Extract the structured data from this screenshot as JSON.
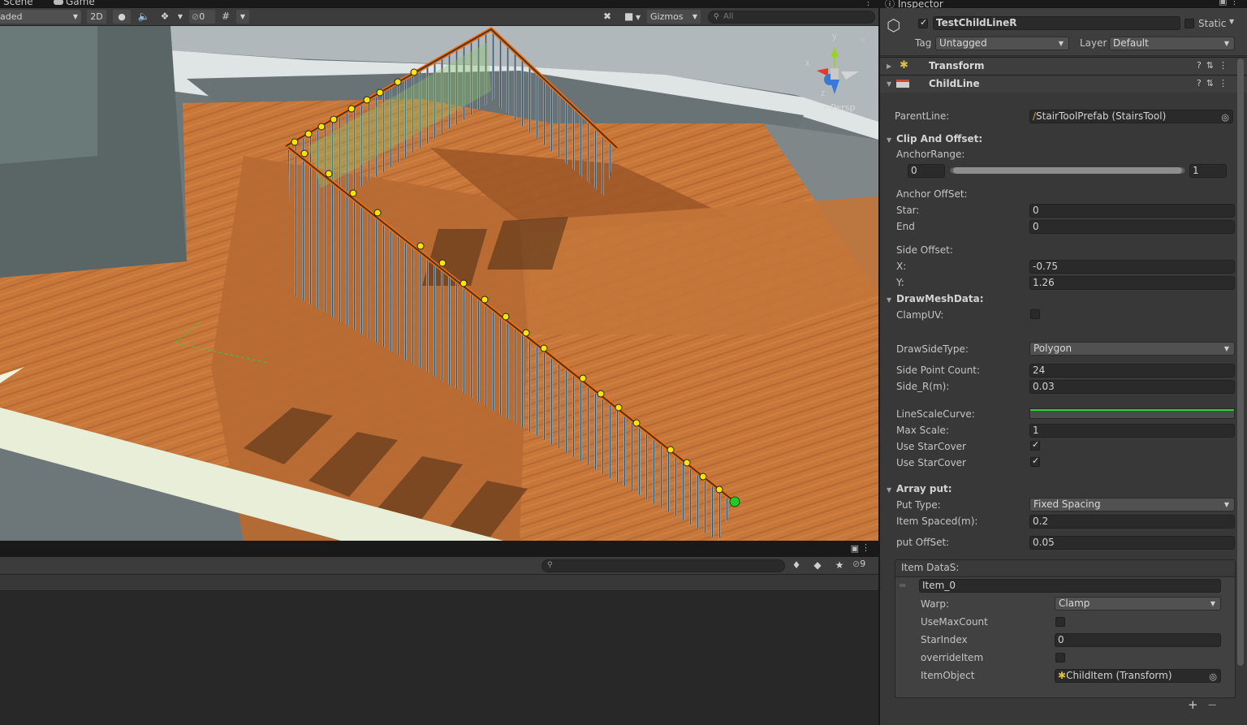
{
  "tabs": {
    "scene": "Scene",
    "game": "Game",
    "inspector": "Inspector"
  },
  "scene_toolbar": {
    "shading_mode": "aded",
    "mode_2d": "2D",
    "hidden_count": "0",
    "gizmos": "Gizmos",
    "search_placeholder": "All"
  },
  "scene_gizmo": {
    "axis_x": "x",
    "axis_y": "y",
    "axis_z": "z",
    "projection": "←Persp"
  },
  "bottom_panel": {
    "hidden_count": "9"
  },
  "inspector": {
    "object_name": "TestChildLineR",
    "active": true,
    "static_label": "Static",
    "tag_label": "Tag",
    "tag_value": "Untagged",
    "layer_label": "Layer",
    "layer_value": "Default",
    "components": {
      "transform": "Transform",
      "childline": "ChildLine"
    },
    "childline": {
      "parent_line_label": "ParentLine:",
      "parent_line_value": "StairToolPrefab (StairsTool)",
      "clip_offset_label": "Clip And Offset:",
      "anchor_range_label": "AnchorRange:",
      "anchor_range_min": "0",
      "anchor_range_max": "1",
      "anchor_offset_label": "Anchor OffSet:",
      "star_label": "Star:",
      "star_value": "0",
      "end_label": "End",
      "end_value": "0",
      "side_offset_label": "Side Offset:",
      "x_label": "X:",
      "x_value": "-0.75",
      "y_label": "Y:",
      "y_value": "1.26",
      "draw_mesh_label": "DrawMeshData:",
      "clamp_uv_label": "ClampUV:",
      "clamp_uv": false,
      "draw_side_type_label": "DrawSideType:",
      "draw_side_type_value": "Polygon",
      "side_point_count_label": "Side Point Count:",
      "side_point_count_value": "24",
      "side_r_label": "Side_R(m):",
      "side_r_value": "0.03",
      "line_scale_curve_label": "LineScaleCurve:",
      "max_scale_label": "Max Scale:",
      "max_scale_value": "1",
      "use_star_cover_label": "Use StarCover",
      "use_star_cover": true,
      "use_star_cover2_label": "Use StarCover",
      "use_star_cover2": true,
      "array_put_label": "Array put:",
      "put_type_label": "Put Type:",
      "put_type_value": "Fixed Spacing",
      "item_spaced_label": "Item Spaced(m):",
      "item_spaced_value": "0.2",
      "put_offset_label": "put OffSet:",
      "put_offset_value": "0.05",
      "item_datas_label": "Item DataS:",
      "item": {
        "name": "Item_0",
        "warp_label": "Warp:",
        "warp_value": "Clamp",
        "use_max_count_label": "UseMaxCount",
        "use_max_count": false,
        "star_index_label": "StarIndex",
        "star_index_value": "0",
        "override_item_label": "overrideItem",
        "override_item": false,
        "item_object_label": "ItemObject",
        "item_object_value": "ChildItem (Transform)"
      },
      "list_add": "+",
      "list_remove": "−"
    }
  },
  "colors": {
    "editor_bg": "#282828",
    "panel_bg": "#383838",
    "toolbar_bg": "#3c3c3c",
    "wood": "#c9783c",
    "selection_outline": "#ff6a00",
    "handle_point": "#ffe400",
    "end_point": "#22cc22",
    "wall": "#7b8284",
    "wall_dark": "#5d6467"
  }
}
